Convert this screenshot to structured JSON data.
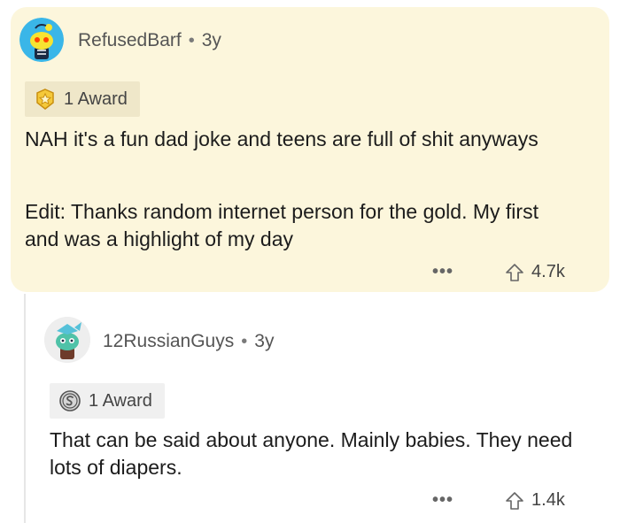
{
  "comments": [
    {
      "username": "RefusedBarf",
      "separator": "•",
      "age": "3y",
      "award_label": "1 Award",
      "award_icon": "star-award-icon",
      "paragraphs": [
        "NAH it's a fun dad joke and teens are full of shit anyways",
        "Edit: Thanks random internet person for the gold. My first and was a highlight of my day"
      ],
      "more": "•••",
      "votes": "4.7k",
      "background": "#fcf6dc"
    },
    {
      "username": "12RussianGuys",
      "separator": "•",
      "age": "3y",
      "award_label": "1 Award",
      "award_icon": "silver-award-icon",
      "paragraphs": [
        "That can be said about anyone. Mainly babies. They need lots of diapers."
      ],
      "more": "•••",
      "votes": "1.4k",
      "background": "#ffffff"
    }
  ]
}
